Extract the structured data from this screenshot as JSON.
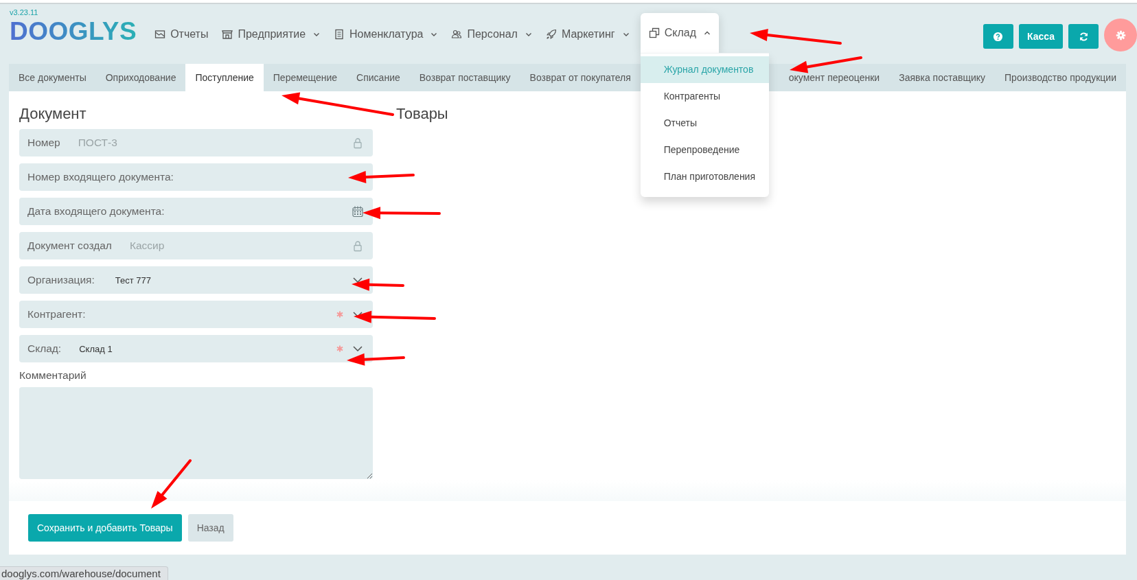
{
  "header": {
    "version": "v3.23.11",
    "logo": "DOOGLYS",
    "nav": [
      {
        "label": "Отчеты",
        "has_menu": false,
        "expanded": false
      },
      {
        "label": "Предприятие",
        "has_menu": true,
        "expanded": false
      },
      {
        "label": "Номенклатура",
        "has_menu": true,
        "expanded": false
      },
      {
        "label": "Персонал",
        "has_menu": true,
        "expanded": false
      },
      {
        "label": "Маркетинг",
        "has_menu": true,
        "expanded": false
      },
      {
        "label": "Склад",
        "has_menu": true,
        "expanded": true,
        "menu": [
          {
            "label": "Журнал документов",
            "selected": true
          },
          {
            "label": "Контрагенты",
            "selected": false
          },
          {
            "label": "Отчеты",
            "selected": false
          },
          {
            "label": "Перепроведение",
            "selected": false
          },
          {
            "label": "План приготовления",
            "selected": false
          }
        ]
      }
    ],
    "actions": [
      {
        "kind": "help"
      },
      {
        "kind": "text",
        "label": "Касса"
      },
      {
        "kind": "refresh"
      },
      {
        "kind": "settings"
      }
    ]
  },
  "tabs": [
    {
      "label": "Все документы",
      "selected": false
    },
    {
      "label": "Оприходование",
      "selected": false
    },
    {
      "label": "Поступление",
      "selected": true
    },
    {
      "label": "Перемещение",
      "selected": false
    },
    {
      "label": "Списание",
      "selected": false
    },
    {
      "label": "Возврат поставщику",
      "selected": false
    },
    {
      "label": "Возврат от покупателя",
      "selected": false
    },
    {
      "label": "окумент переоценки",
      "selected": false
    },
    {
      "label": "Заявка поставщику",
      "selected": false
    },
    {
      "label": "Производство продукции",
      "selected": false
    }
  ],
  "document": {
    "title": "Документ",
    "fields": [
      {
        "kind": "locked",
        "label": "Номер",
        "value": "ПОСТ-3",
        "required": false
      },
      {
        "kind": "text",
        "label": "Номер входящего документа:",
        "required": false
      },
      {
        "kind": "date",
        "label": "Дата входящего документа:",
        "required": false
      },
      {
        "kind": "locked",
        "label": "Документ создал",
        "value": "Кассир",
        "required": false
      },
      {
        "kind": "select",
        "label": "Организация:",
        "value": "Тест 777",
        "required": false
      },
      {
        "kind": "select",
        "label": "Контрагент:",
        "required": true
      },
      {
        "kind": "select",
        "label": "Склад:",
        "value": "Склад 1",
        "required": true
      }
    ],
    "comment_label": "Комментарий"
  },
  "goods": {
    "title": "Товары"
  },
  "buttons": [
    {
      "kind": "primary",
      "label": "Сохранить и добавить Товары"
    },
    {
      "kind": "secondary",
      "label": "Назад"
    }
  ],
  "status_url": "dooglys.com/warehouse/document"
}
